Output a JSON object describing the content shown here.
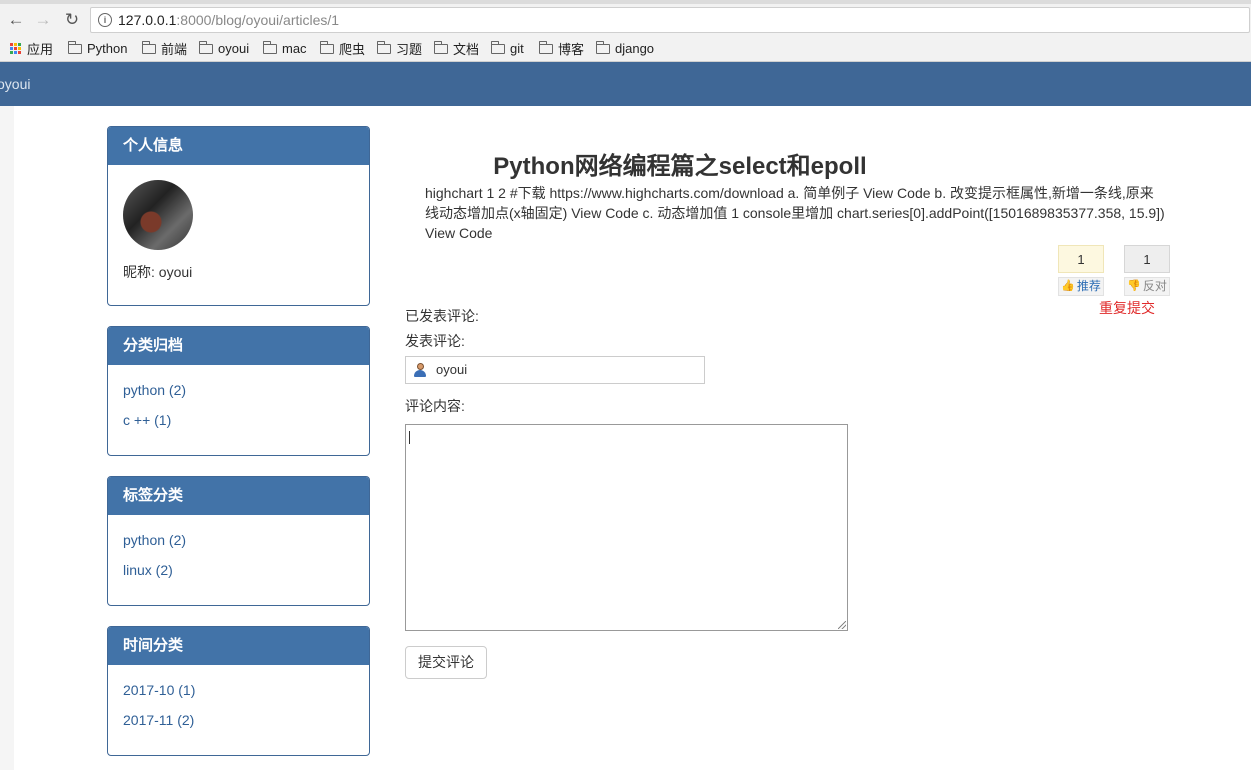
{
  "browser": {
    "url_host": "127.0.0.1",
    "url_path": ":8000/blog/oyoui/articles/1",
    "bookmarks": [
      "应用",
      "Python",
      "前端",
      "oyoui",
      "mac",
      "爬虫",
      "习题",
      "文档",
      "git",
      "博客",
      "django"
    ]
  },
  "header": {
    "brand": "oyoui"
  },
  "sidebar": {
    "profile": {
      "title": "个人信息",
      "nickname": "昵称: oyoui"
    },
    "categories": {
      "title": "分类归档",
      "items": [
        "python (2)",
        "c ++ (1)"
      ]
    },
    "tags": {
      "title": "标签分类",
      "items": [
        "python (2)",
        "linux (2)"
      ]
    },
    "archive": {
      "title": "时间分类",
      "items": [
        "2017-10 (1)",
        "2017-11 (2)"
      ]
    }
  },
  "article": {
    "title": "Python网络编程篇之select和epoll",
    "summary": "highchart 1 2 #下载 https://www.highcharts.com/download a. 简单例子 View Code b. 改变提示框属性,新增一条线,原来线动态增加点(x轴固定) View Code c. 动态增加值 1 console里增加 chart.series[0].addPoint([1501689835377.358, 15.9]) View Code"
  },
  "votes": {
    "up_count": "1",
    "down_count": "1",
    "up_label": "推荐",
    "down_label": "反对",
    "message": "重复提交"
  },
  "comments": {
    "posted_label": "已发表评论:",
    "post_label": "发表评论:",
    "username": "oyoui",
    "content_label": "评论内容:",
    "submit_label": "提交评论"
  },
  "colors": {
    "header_bg": "#3f6796",
    "panel_heading": "#4273a8",
    "link": "#2f5f96",
    "error": "#e02b2b"
  }
}
